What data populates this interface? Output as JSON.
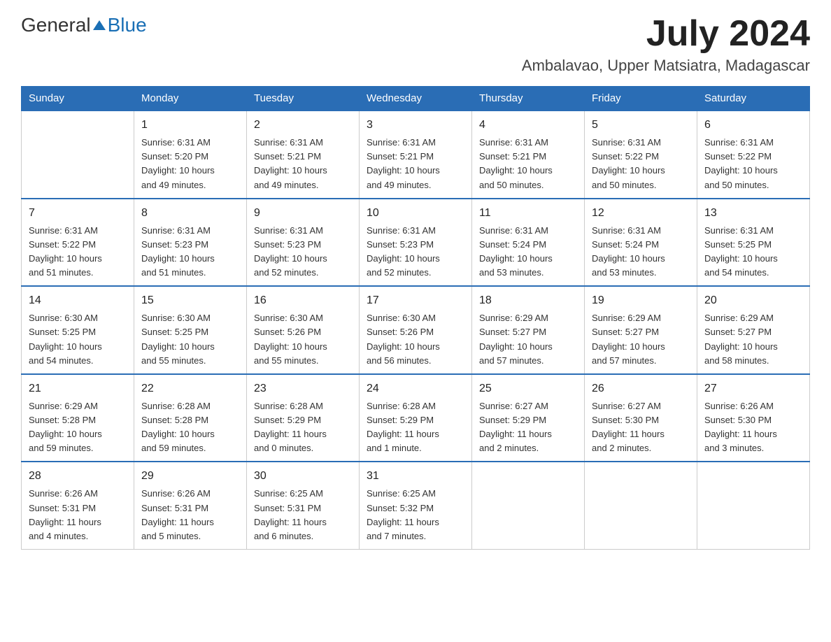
{
  "header": {
    "logo": {
      "general": "General",
      "blue": "Blue",
      "alt": "GeneralBlue logo"
    },
    "title": "July 2024",
    "location": "Ambalavao, Upper Matsiatra, Madagascar"
  },
  "calendar": {
    "days_of_week": [
      "Sunday",
      "Monday",
      "Tuesday",
      "Wednesday",
      "Thursday",
      "Friday",
      "Saturday"
    ],
    "weeks": [
      [
        {
          "day": "",
          "info": ""
        },
        {
          "day": "1",
          "info": "Sunrise: 6:31 AM\nSunset: 5:20 PM\nDaylight: 10 hours\nand 49 minutes."
        },
        {
          "day": "2",
          "info": "Sunrise: 6:31 AM\nSunset: 5:21 PM\nDaylight: 10 hours\nand 49 minutes."
        },
        {
          "day": "3",
          "info": "Sunrise: 6:31 AM\nSunset: 5:21 PM\nDaylight: 10 hours\nand 49 minutes."
        },
        {
          "day": "4",
          "info": "Sunrise: 6:31 AM\nSunset: 5:21 PM\nDaylight: 10 hours\nand 50 minutes."
        },
        {
          "day": "5",
          "info": "Sunrise: 6:31 AM\nSunset: 5:22 PM\nDaylight: 10 hours\nand 50 minutes."
        },
        {
          "day": "6",
          "info": "Sunrise: 6:31 AM\nSunset: 5:22 PM\nDaylight: 10 hours\nand 50 minutes."
        }
      ],
      [
        {
          "day": "7",
          "info": "Sunrise: 6:31 AM\nSunset: 5:22 PM\nDaylight: 10 hours\nand 51 minutes."
        },
        {
          "day": "8",
          "info": "Sunrise: 6:31 AM\nSunset: 5:23 PM\nDaylight: 10 hours\nand 51 minutes."
        },
        {
          "day": "9",
          "info": "Sunrise: 6:31 AM\nSunset: 5:23 PM\nDaylight: 10 hours\nand 52 minutes."
        },
        {
          "day": "10",
          "info": "Sunrise: 6:31 AM\nSunset: 5:23 PM\nDaylight: 10 hours\nand 52 minutes."
        },
        {
          "day": "11",
          "info": "Sunrise: 6:31 AM\nSunset: 5:24 PM\nDaylight: 10 hours\nand 53 minutes."
        },
        {
          "day": "12",
          "info": "Sunrise: 6:31 AM\nSunset: 5:24 PM\nDaylight: 10 hours\nand 53 minutes."
        },
        {
          "day": "13",
          "info": "Sunrise: 6:31 AM\nSunset: 5:25 PM\nDaylight: 10 hours\nand 54 minutes."
        }
      ],
      [
        {
          "day": "14",
          "info": "Sunrise: 6:30 AM\nSunset: 5:25 PM\nDaylight: 10 hours\nand 54 minutes."
        },
        {
          "day": "15",
          "info": "Sunrise: 6:30 AM\nSunset: 5:25 PM\nDaylight: 10 hours\nand 55 minutes."
        },
        {
          "day": "16",
          "info": "Sunrise: 6:30 AM\nSunset: 5:26 PM\nDaylight: 10 hours\nand 55 minutes."
        },
        {
          "day": "17",
          "info": "Sunrise: 6:30 AM\nSunset: 5:26 PM\nDaylight: 10 hours\nand 56 minutes."
        },
        {
          "day": "18",
          "info": "Sunrise: 6:29 AM\nSunset: 5:27 PM\nDaylight: 10 hours\nand 57 minutes."
        },
        {
          "day": "19",
          "info": "Sunrise: 6:29 AM\nSunset: 5:27 PM\nDaylight: 10 hours\nand 57 minutes."
        },
        {
          "day": "20",
          "info": "Sunrise: 6:29 AM\nSunset: 5:27 PM\nDaylight: 10 hours\nand 58 minutes."
        }
      ],
      [
        {
          "day": "21",
          "info": "Sunrise: 6:29 AM\nSunset: 5:28 PM\nDaylight: 10 hours\nand 59 minutes."
        },
        {
          "day": "22",
          "info": "Sunrise: 6:28 AM\nSunset: 5:28 PM\nDaylight: 10 hours\nand 59 minutes."
        },
        {
          "day": "23",
          "info": "Sunrise: 6:28 AM\nSunset: 5:29 PM\nDaylight: 11 hours\nand 0 minutes."
        },
        {
          "day": "24",
          "info": "Sunrise: 6:28 AM\nSunset: 5:29 PM\nDaylight: 11 hours\nand 1 minute."
        },
        {
          "day": "25",
          "info": "Sunrise: 6:27 AM\nSunset: 5:29 PM\nDaylight: 11 hours\nand 2 minutes."
        },
        {
          "day": "26",
          "info": "Sunrise: 6:27 AM\nSunset: 5:30 PM\nDaylight: 11 hours\nand 2 minutes."
        },
        {
          "day": "27",
          "info": "Sunrise: 6:26 AM\nSunset: 5:30 PM\nDaylight: 11 hours\nand 3 minutes."
        }
      ],
      [
        {
          "day": "28",
          "info": "Sunrise: 6:26 AM\nSunset: 5:31 PM\nDaylight: 11 hours\nand 4 minutes."
        },
        {
          "day": "29",
          "info": "Sunrise: 6:26 AM\nSunset: 5:31 PM\nDaylight: 11 hours\nand 5 minutes."
        },
        {
          "day": "30",
          "info": "Sunrise: 6:25 AM\nSunset: 5:31 PM\nDaylight: 11 hours\nand 6 minutes."
        },
        {
          "day": "31",
          "info": "Sunrise: 6:25 AM\nSunset: 5:32 PM\nDaylight: 11 hours\nand 7 minutes."
        },
        {
          "day": "",
          "info": ""
        },
        {
          "day": "",
          "info": ""
        },
        {
          "day": "",
          "info": ""
        }
      ]
    ]
  }
}
